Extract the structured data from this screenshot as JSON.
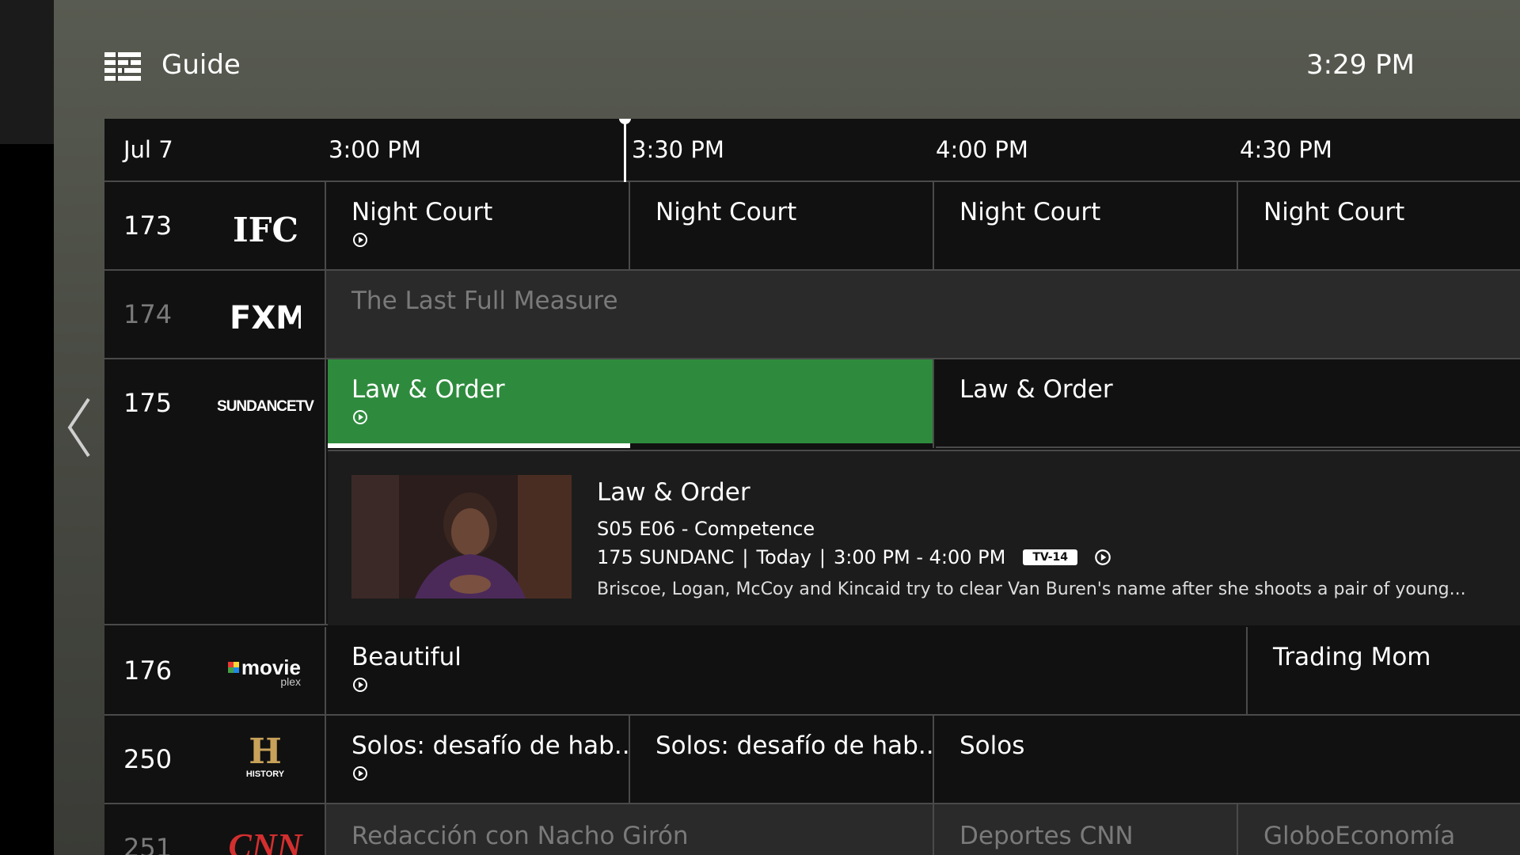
{
  "header": {
    "title": "Guide",
    "clock": "3:29 PM"
  },
  "timebar": {
    "date": "Jul 7",
    "slots": [
      "3:00 PM",
      "3:30 PM",
      "4:00 PM",
      "4:30 PM"
    ]
  },
  "channels": [
    {
      "number": "173",
      "logo": "IFC",
      "programs": [
        "Night Court",
        "Night Court",
        "Night Court",
        "Night Court"
      ]
    },
    {
      "number": "174",
      "logo": "FXM",
      "programs": [
        "The Last Full Measure"
      ]
    },
    {
      "number": "175",
      "logo_text": "SUNDANCETV",
      "programs": [
        "Law & Order",
        "Law & Order"
      ]
    },
    {
      "number": "176",
      "logo_text": "movie",
      "logo_sub": "plex",
      "programs": [
        "Beautiful",
        "Trading Mom"
      ]
    },
    {
      "number": "250",
      "logo_text": "H",
      "logo_sub": "HISTORY",
      "programs": [
        "Solos: desafío de hab...",
        "Solos: desafío de hab...",
        "Solos"
      ]
    },
    {
      "number": "251",
      "logo_text": "CNN",
      "programs": [
        "Redacción con Nacho Girón",
        "Deportes CNN",
        "GloboEconomía"
      ]
    }
  ],
  "selected_program_progress": 0.5,
  "detail": {
    "title": "Law & Order",
    "episode": "S05 E06  -  Competence",
    "channel": "175 SUNDANC",
    "day": "Today",
    "time": "3:00 PM - 4:00 PM",
    "rating": "TV-14",
    "description": "Briscoe, Logan, McCoy and Kincaid try to clear Van Buren's name after she shoots a pair of young..."
  },
  "colors": {
    "selected": "#2e8b3d",
    "accent": "#ffffff"
  }
}
